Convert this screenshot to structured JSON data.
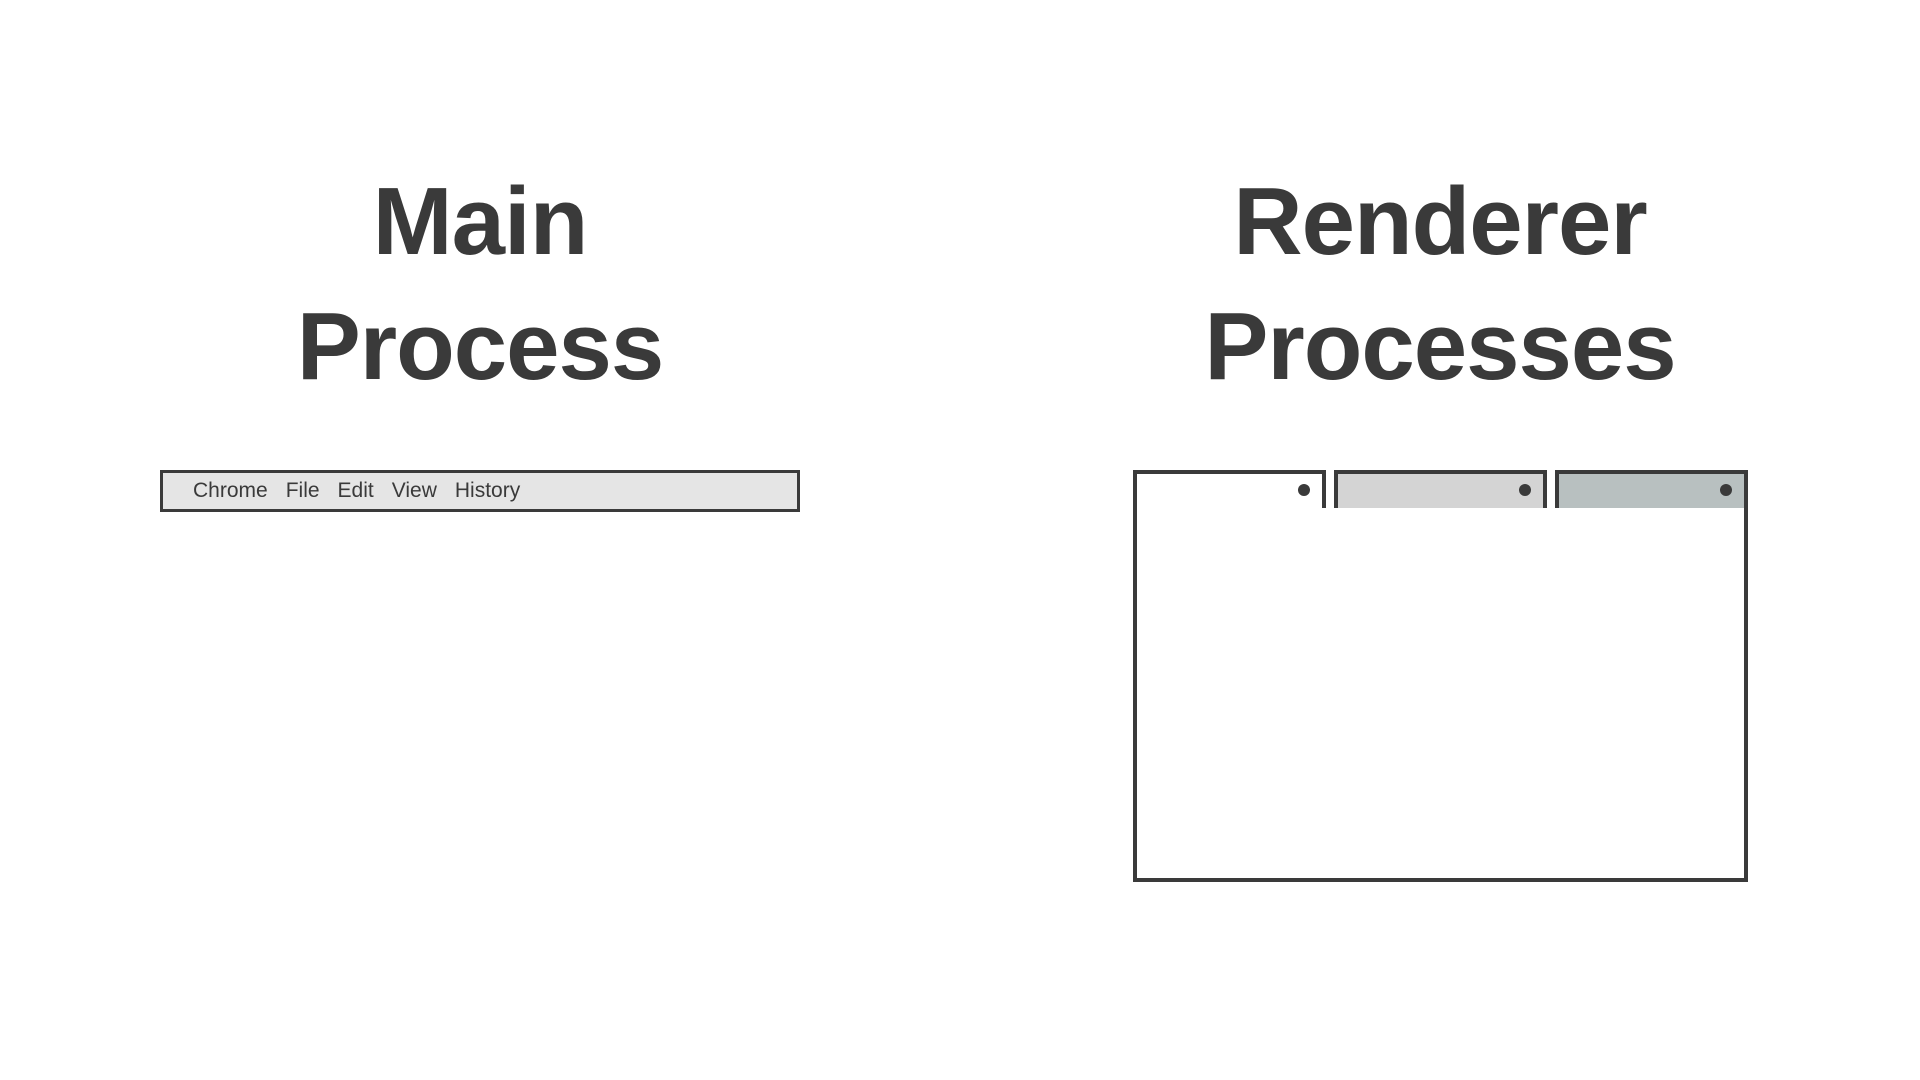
{
  "leftHeading": {
    "line1": "Main",
    "line2": "Process"
  },
  "rightHeading": {
    "line1": "Renderer",
    "line2": "Processes"
  },
  "menuBar": {
    "items": [
      "Chrome",
      "File",
      "Edit",
      "View",
      "History"
    ]
  }
}
